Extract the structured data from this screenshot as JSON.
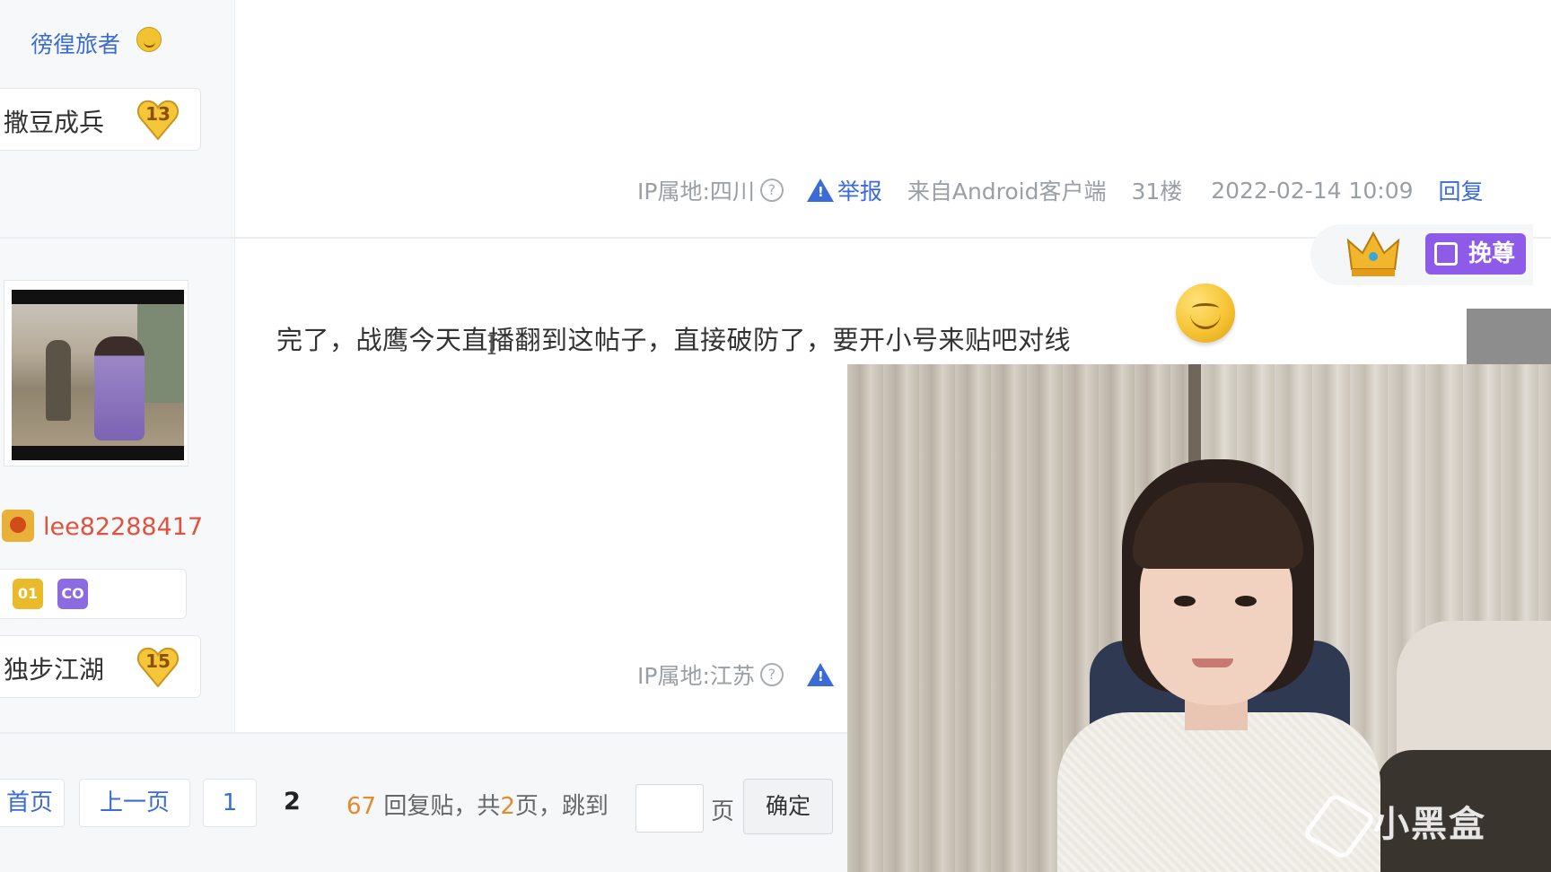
{
  "post1": {
    "author_name": "徬徨旅者",
    "level_name": "撒豆成兵",
    "level": "13",
    "ip_location": "IP属地:四川",
    "report": "举报",
    "client": "来自Android客户端",
    "floor": "31楼",
    "timestamp": "2022-02-14 10:09",
    "reply": "回复"
  },
  "post2": {
    "author_name": "lee82288417",
    "badges": [
      "01",
      "CO"
    ],
    "level_name": "独步江湖",
    "level": "15",
    "content": "完了，战鹰今天直播翻到这帖子，直接破防了，要开小号来贴吧对线",
    "ip_location": "IP属地:江苏",
    "recommend": "挽尊"
  },
  "pager": {
    "first": "首页",
    "prev": "上一页",
    "page1": "1",
    "current": "2",
    "reply_count": "67",
    "reply_label": "回复贴，共",
    "total_pages": "2",
    "pages_label": "页，跳到",
    "page_label": "页",
    "confirm": "确定"
  },
  "overlay": {
    "watermark": "小黑盒"
  },
  "colors": {
    "link": "#3a6bd6",
    "author_red": "#e2513d",
    "recommend_purple": "#8e5ae8",
    "count_orange": "#e58a2c"
  }
}
